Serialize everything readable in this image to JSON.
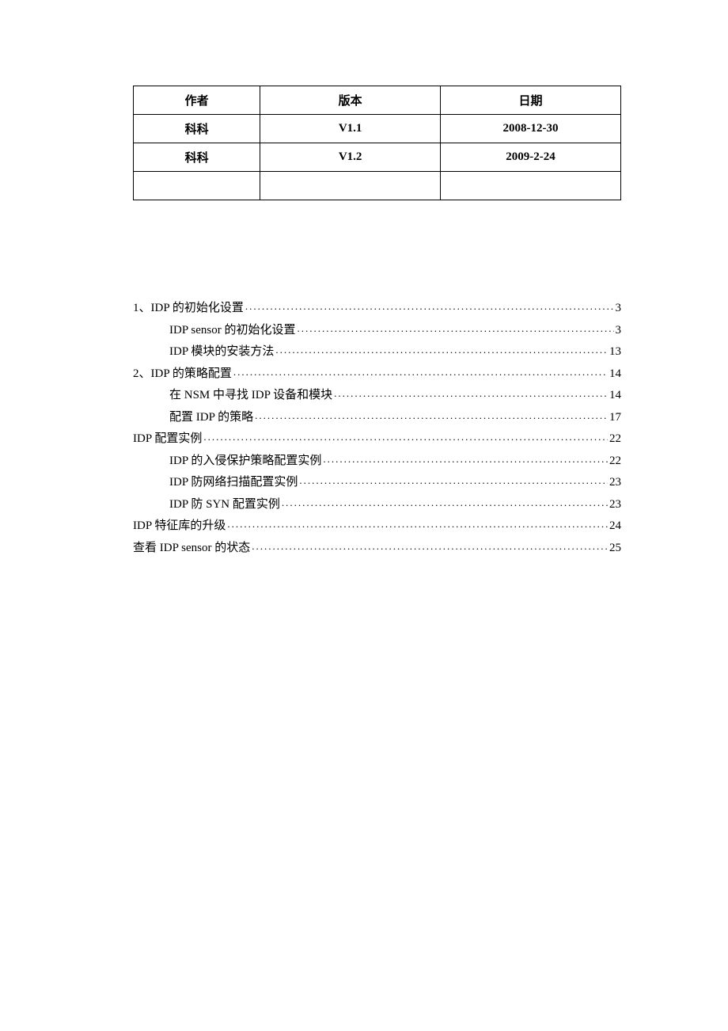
{
  "version_table": {
    "headers": [
      "作者",
      "版本",
      "日期"
    ],
    "rows": [
      [
        "科科",
        "V1.1",
        "2008-12-30"
      ],
      [
        "科科",
        "V1.2",
        "2009-2-24"
      ],
      [
        "",
        "",
        ""
      ]
    ]
  },
  "toc": [
    {
      "label": "1、IDP 的初始化设置",
      "page": "3",
      "indent": 0
    },
    {
      "label": "IDP sensor 的初始化设置",
      "page": "3",
      "indent": 1
    },
    {
      "label": "IDP 模块的安装方法",
      "page": "13",
      "indent": 1
    },
    {
      "label": "2、IDP 的策略配置",
      "page": "14",
      "indent": 0
    },
    {
      "label": "在 NSM 中寻找 IDP 设备和模块",
      "page": "14",
      "indent": 1
    },
    {
      "label": "配置 IDP 的策略",
      "page": "17",
      "indent": 1
    },
    {
      "label": "IDP 配置实例",
      "page": "22",
      "indent": 0
    },
    {
      "label": "IDP 的入侵保护策略配置实例",
      "page": "22",
      "indent": 1
    },
    {
      "label": "IDP 防网络扫描配置实例",
      "page": "23",
      "indent": 1
    },
    {
      "label": "IDP 防 SYN 配置实例",
      "page": "23",
      "indent": 1
    },
    {
      "label": "IDP 特征库的升级",
      "page": "24",
      "indent": 0
    },
    {
      "label": "查看 IDP sensor 的状态",
      "page": "25",
      "indent": 0
    }
  ]
}
